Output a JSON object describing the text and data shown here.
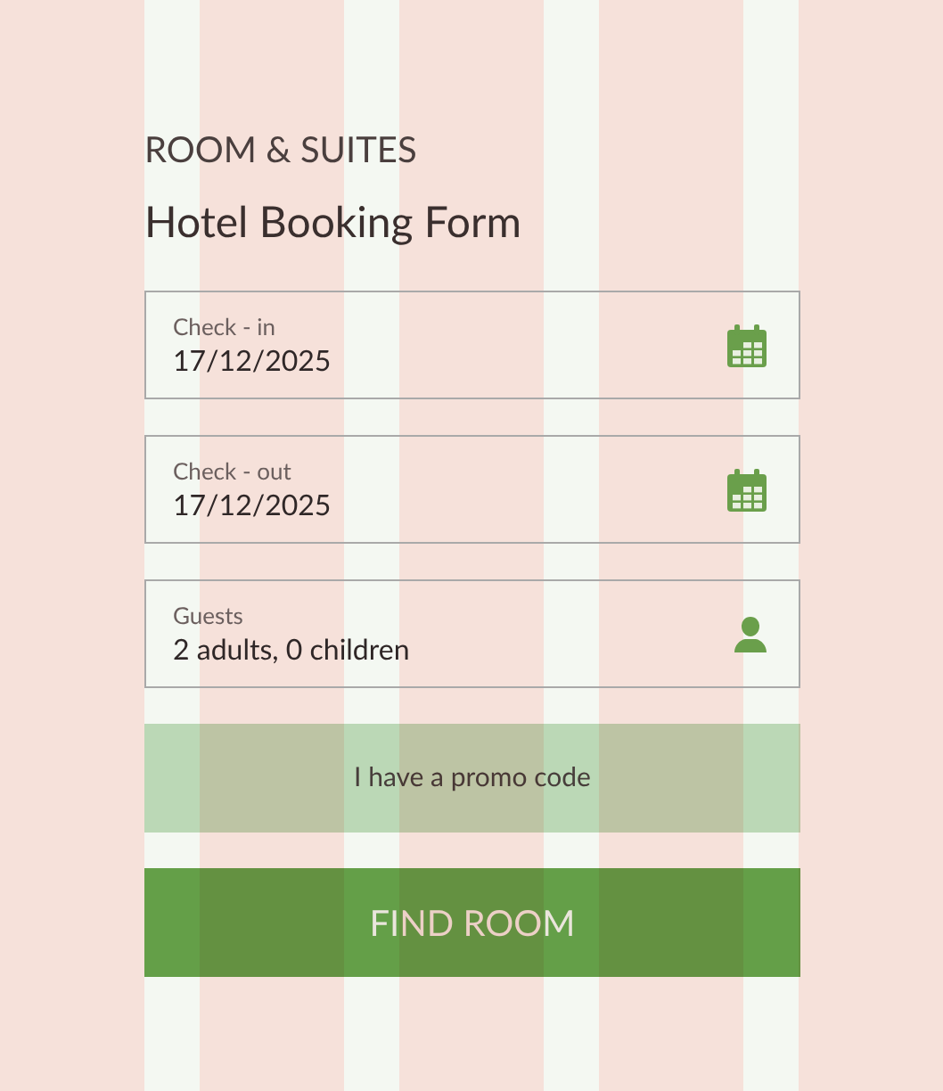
{
  "eyebrow": "ROOM & SUITES",
  "title": "Hotel Booking Form",
  "fields": [
    {
      "kind": "date",
      "label": "Check - in",
      "value": "17/12/2025"
    },
    {
      "kind": "date",
      "label": "Check - out",
      "value": "17/12/2025"
    },
    {
      "kind": "guests",
      "label": "Guests",
      "value": "2 adults, 0 children"
    }
  ],
  "promo_button": "I have a promo code",
  "submit_button": "FIND ROOM"
}
